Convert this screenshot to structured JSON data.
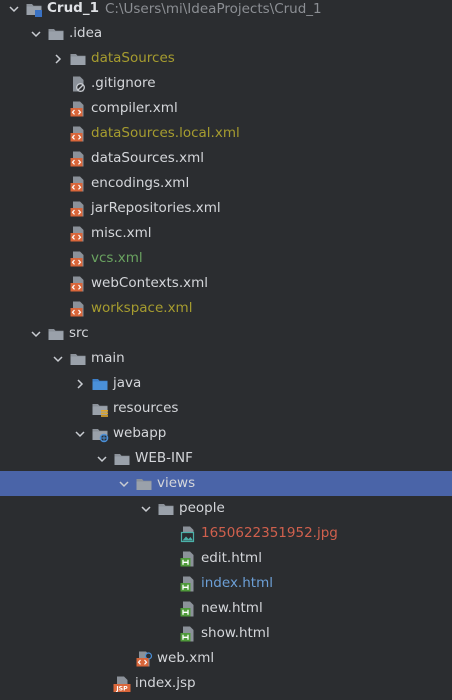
{
  "project": {
    "name": "Crud_1",
    "path": "C:\\Users\\mi\\IdeaProjects\\Crud_1"
  },
  "tree": [
    {
      "id": "crud1",
      "label": "Crud_1",
      "level": 0,
      "expanded": true,
      "icon": "module-folder-icon",
      "color": "#dfe1e5"
    },
    {
      "id": "idea",
      "label": ".idea",
      "level": 1,
      "expanded": true,
      "icon": "folder-icon",
      "color": "#d4d6da"
    },
    {
      "id": "datasources-dir",
      "label": "dataSources",
      "level": 2,
      "expanded": false,
      "icon": "folder-icon",
      "color": "#a69c2f"
    },
    {
      "id": "gitignore",
      "label": ".gitignore",
      "level": 2,
      "icon": "ignore-file-icon",
      "color": "#d4d6da"
    },
    {
      "id": "compiler-xml",
      "label": "compiler.xml",
      "level": 2,
      "icon": "xml-file-icon",
      "color": "#d4d6da"
    },
    {
      "id": "datasources-local-xml",
      "label": "dataSources.local.xml",
      "level": 2,
      "icon": "xml-file-icon",
      "color": "#a69c2f"
    },
    {
      "id": "datasources-xml",
      "label": "dataSources.xml",
      "level": 2,
      "icon": "xml-file-icon",
      "color": "#d4d6da"
    },
    {
      "id": "encodings-xml",
      "label": "encodings.xml",
      "level": 2,
      "icon": "xml-file-icon",
      "color": "#d4d6da"
    },
    {
      "id": "jarrepositories-xml",
      "label": "jarRepositories.xml",
      "level": 2,
      "icon": "xml-file-icon",
      "color": "#d4d6da"
    },
    {
      "id": "misc-xml",
      "label": "misc.xml",
      "level": 2,
      "icon": "xml-file-icon",
      "color": "#d4d6da"
    },
    {
      "id": "vcs-xml",
      "label": "vcs.xml",
      "level": 2,
      "icon": "xml-file-icon",
      "color": "#6aa360"
    },
    {
      "id": "webcontexts-xml",
      "label": "webContexts.xml",
      "level": 2,
      "icon": "xml-file-icon",
      "color": "#d4d6da"
    },
    {
      "id": "workspace-xml",
      "label": "workspace.xml",
      "level": 2,
      "icon": "xml-file-icon",
      "color": "#a69c2f"
    },
    {
      "id": "src",
      "label": "src",
      "level": 1,
      "expanded": true,
      "icon": "folder-icon",
      "color": "#d4d6da"
    },
    {
      "id": "main",
      "label": "main",
      "level": 2,
      "expanded": true,
      "icon": "folder-icon",
      "color": "#d4d6da"
    },
    {
      "id": "java",
      "label": "java",
      "level": 3,
      "expanded": false,
      "icon": "source-folder-icon",
      "color": "#d4d6da"
    },
    {
      "id": "resources",
      "label": "resources",
      "level": 3,
      "icon": "resources-folder-icon",
      "color": "#d4d6da"
    },
    {
      "id": "webapp",
      "label": "webapp",
      "level": 3,
      "expanded": true,
      "icon": "web-folder-icon",
      "color": "#d4d6da"
    },
    {
      "id": "web-inf",
      "label": "WEB-INF",
      "level": 4,
      "expanded": true,
      "icon": "folder-icon",
      "color": "#d4d6da"
    },
    {
      "id": "views",
      "label": "views",
      "level": 5,
      "expanded": true,
      "icon": "folder-icon",
      "color": "#d4d6da",
      "selected": true
    },
    {
      "id": "people",
      "label": "people",
      "level": 6,
      "expanded": true,
      "icon": "folder-icon",
      "color": "#d4d6da"
    },
    {
      "id": "jpg",
      "label": "1650622351952.jpg",
      "level": 7,
      "icon": "image-file-icon",
      "color": "#d0604d"
    },
    {
      "id": "edit-html",
      "label": "edit.html",
      "level": 7,
      "icon": "html-file-icon",
      "color": "#d4d6da"
    },
    {
      "id": "index-html",
      "label": "index.html",
      "level": 7,
      "icon": "html-file-icon",
      "color": "#6c9fd6"
    },
    {
      "id": "new-html",
      "label": "new.html",
      "level": 7,
      "icon": "html-file-icon",
      "color": "#d4d6da"
    },
    {
      "id": "show-html",
      "label": "show.html",
      "level": 7,
      "icon": "html-file-icon",
      "color": "#d4d6da"
    },
    {
      "id": "web-xml",
      "label": "web.xml",
      "level": 5,
      "icon": "web-xml-file-icon",
      "color": "#d4d6da"
    },
    {
      "id": "index-jsp",
      "label": "index.jsp",
      "level": 4,
      "icon": "jsp-file-icon",
      "color": "#d4d6da"
    }
  ],
  "colors": {
    "background": "#2b2d30",
    "selection": "#4a64a8",
    "modified_olive": "#a69c2f",
    "added_green": "#6aa360",
    "untracked_red": "#d0604d",
    "changed_blue": "#6c9fd6"
  }
}
